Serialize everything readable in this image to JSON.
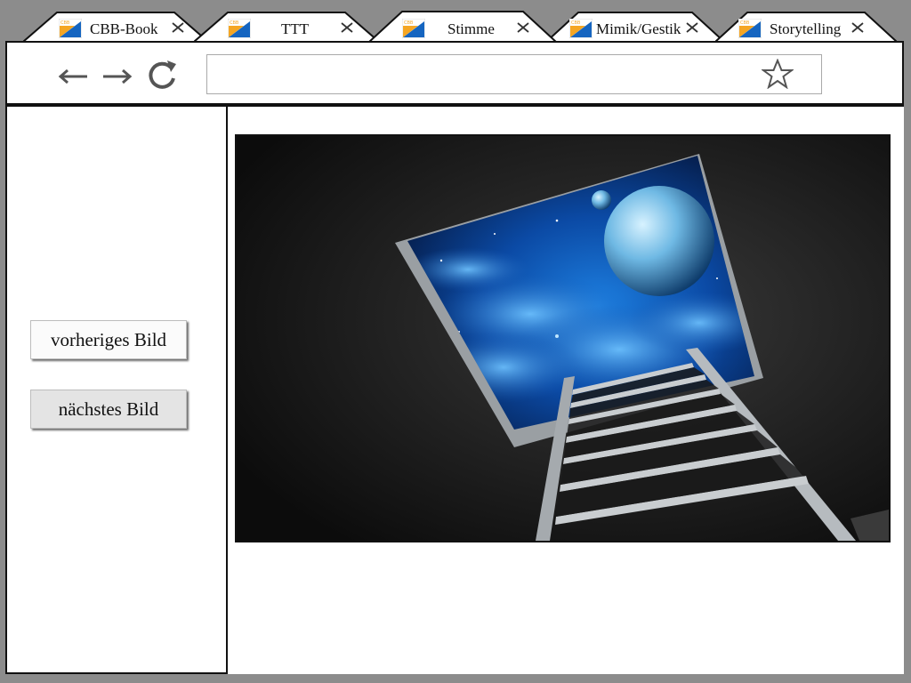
{
  "tabs": [
    {
      "label": "CBB-Book",
      "active": false
    },
    {
      "label": "TTT",
      "active": false
    },
    {
      "label": "Stimme",
      "active": true
    },
    {
      "label": "Mimik/Gestik",
      "active": false
    },
    {
      "label": "Storytelling",
      "active": false
    }
  ],
  "toolbar": {
    "back_icon": "arrow-left-icon",
    "forward_icon": "arrow-right-icon",
    "reload_icon": "reload-icon",
    "bookmark_icon": "star-icon"
  },
  "address_bar": {
    "value": ""
  },
  "sidebar": {
    "prev_label": "vorheriges Bild",
    "next_label": "nächstes Bild"
  },
  "content": {
    "image_subject": "ladder-to-space-image"
  },
  "colors": {
    "background": "#8c8c8c",
    "panel": "#ffffff",
    "border": "#111111",
    "space_blue": "#1e6fd6"
  }
}
